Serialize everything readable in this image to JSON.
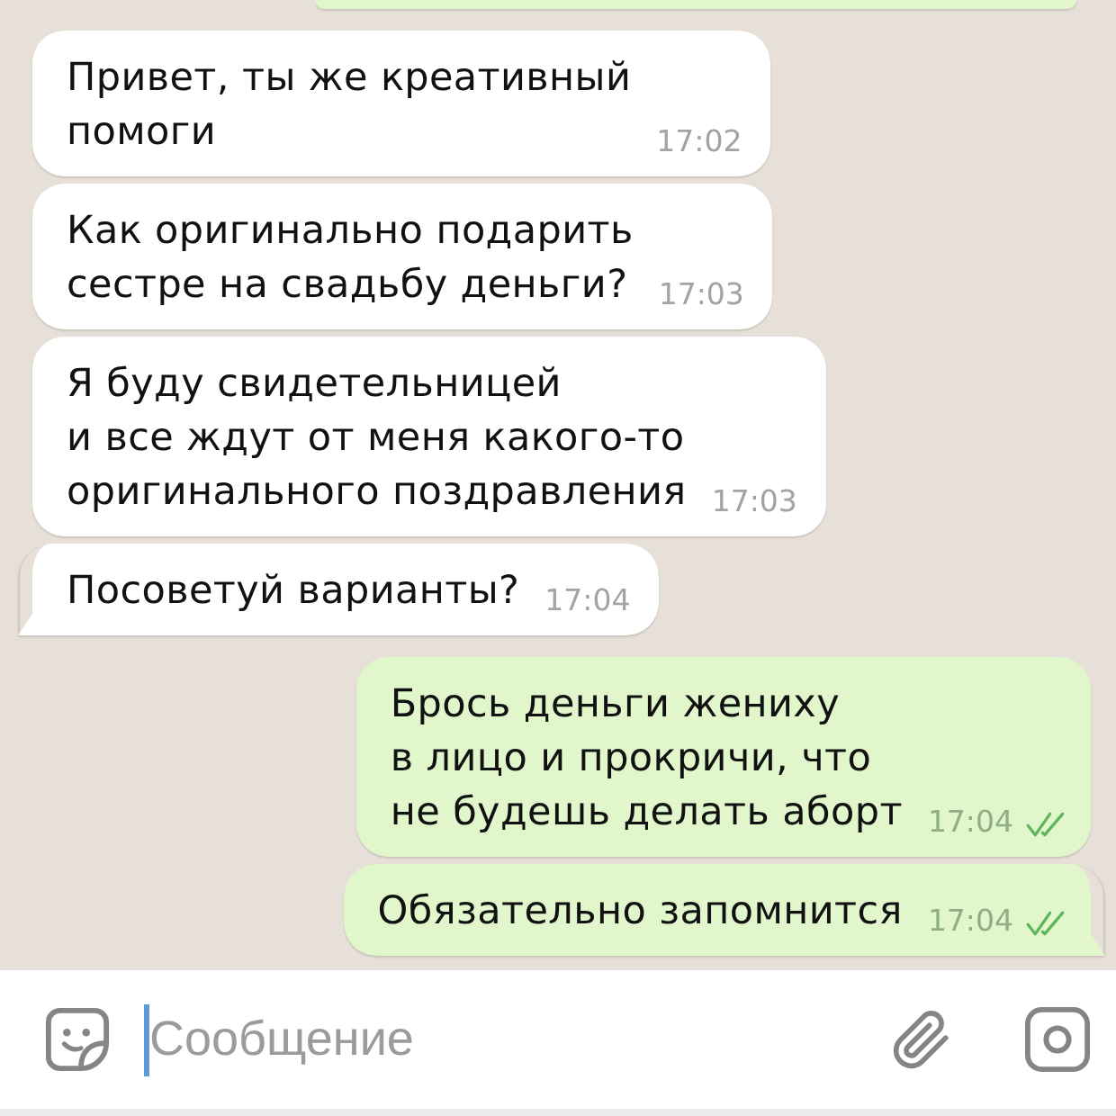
{
  "cut_off_message": {
    "kind": "outgoing"
  },
  "messages": [
    {
      "kind": "incoming",
      "text": "Привет, ты же креативный\nпомоги",
      "time": "17:02"
    },
    {
      "kind": "incoming",
      "text": "Как оригинально подарить\nсестре на свадьбу деньги?",
      "time": "17:03"
    },
    {
      "kind": "incoming",
      "text": "Я буду свидетельницей\nи все ждут от меня какого-то\nоригинального поздравления",
      "time": "17:03"
    },
    {
      "kind": "incoming",
      "text": "Посоветуй варианты?",
      "time": "17:04"
    },
    {
      "kind": "outgoing",
      "text": "Брось деньги жениху\nв лицо и прокричи, что\nне будешь делать аборт",
      "time": "17:04",
      "read": true
    },
    {
      "kind": "outgoing",
      "text": "Обязательно запомнится",
      "time": "17:04",
      "read": true
    }
  ],
  "composer": {
    "placeholder": "Сообщение",
    "focused": true
  }
}
